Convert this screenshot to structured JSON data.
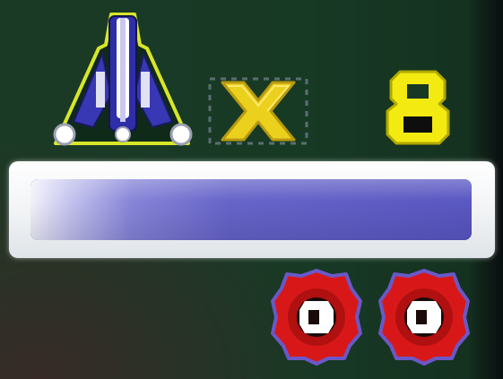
{
  "hud": {
    "player_ship": {
      "icon": "ship-icon",
      "color_fill": "#3a3ab8",
      "color_outline": "#d8e62a"
    },
    "multiplier_sign": {
      "icon": "times-icon",
      "color": "#ecd01e"
    },
    "lives": {
      "label": "8",
      "color": "#f2ea10"
    },
    "gauge": {
      "level": 1.0,
      "frame_color": "#ffffff",
      "fill_color": "#6664c8"
    },
    "bombs": [
      {
        "icon": "bomb-icon",
        "color": "#d81818"
      },
      {
        "icon": "bomb-icon",
        "color": "#d81818"
      }
    ]
  }
}
